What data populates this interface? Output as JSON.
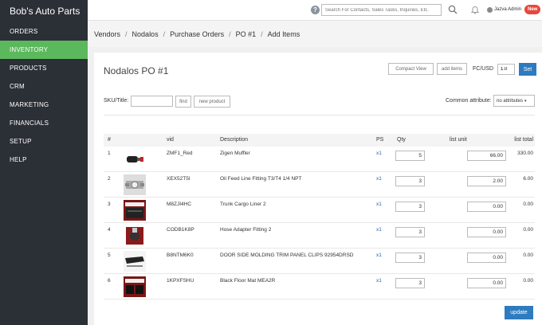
{
  "brand": "Bob's Auto Parts",
  "sidebar": {
    "items": [
      {
        "label": "ORDERS",
        "active": false
      },
      {
        "label": "INVENTORY",
        "active": true
      },
      {
        "label": "PRODUCTS",
        "active": false
      },
      {
        "label": "CRM",
        "active": false
      },
      {
        "label": "MARKETING",
        "active": false
      },
      {
        "label": "FINANCIALS",
        "active": false
      },
      {
        "label": "SETUP",
        "active": false
      },
      {
        "label": "HELP",
        "active": false
      }
    ]
  },
  "topbar": {
    "help_glyph": "?",
    "search_placeholder": "Search For Contacts, Sales Tasks, Inquiries, Etc.",
    "user_name": "Jazva Admin",
    "badge": "New"
  },
  "breadcrumb": [
    "Vendors",
    "Nodalos",
    "Purchase Orders",
    "PO #1",
    "Add Items"
  ],
  "page": {
    "title": "Nodalos PO #1",
    "compact_view": "Compact View",
    "add_items": "add items",
    "fc_label": "FC/USD",
    "fc_value": "1.0",
    "set": "Set",
    "sku_label": "SKU/Title:",
    "find": "find",
    "new_product": "new product",
    "attr_label": "Common attribute:",
    "attr_value": "no attributes",
    "update": "update"
  },
  "table": {
    "headers": {
      "num": "#",
      "vid": "vid",
      "description": "Description",
      "ps": "PS",
      "qty": "Qty",
      "unit": "list unit",
      "total": "list total"
    },
    "rows": [
      {
        "num": "1",
        "vid": "ZMF1_Red",
        "description": "Zigen Muffler",
        "ps": "x1",
        "qty": "5",
        "unit": "66.00",
        "total": "330.00",
        "thumb": "muffler"
      },
      {
        "num": "2",
        "vid": "XEX52T5I",
        "description": "Oil Feed Line Fitting T3/T4 1/4 NPT",
        "ps": "x1",
        "qty": "3",
        "unit": "2.00",
        "total": "6.00",
        "thumb": "fitting"
      },
      {
        "num": "3",
        "vid": "M8ZJI4HC",
        "description": "Trunk Cargo Liner 2",
        "ps": "x1",
        "qty": "3",
        "unit": "0.00",
        "total": "0.00",
        "thumb": "liner"
      },
      {
        "num": "4",
        "vid": "CODB1K8P",
        "description": "Hose Adapter Fitting 2",
        "ps": "x1",
        "qty": "3",
        "unit": "0.00",
        "total": "0.00",
        "thumb": "adapter"
      },
      {
        "num": "5",
        "vid": "B8NTM6K0",
        "description": "DOOR SIDE MOLDING TRIM PANEL CLIPS 92954DRSD",
        "ps": "x1",
        "qty": "3",
        "unit": "0.00",
        "total": "0.00",
        "thumb": "clips"
      },
      {
        "num": "6",
        "vid": "1KPXFSHU",
        "description": "Black Floor Mat MEA2R",
        "ps": "x1",
        "qty": "3",
        "unit": "0.00",
        "total": "0.00",
        "thumb": "mat"
      }
    ]
  }
}
